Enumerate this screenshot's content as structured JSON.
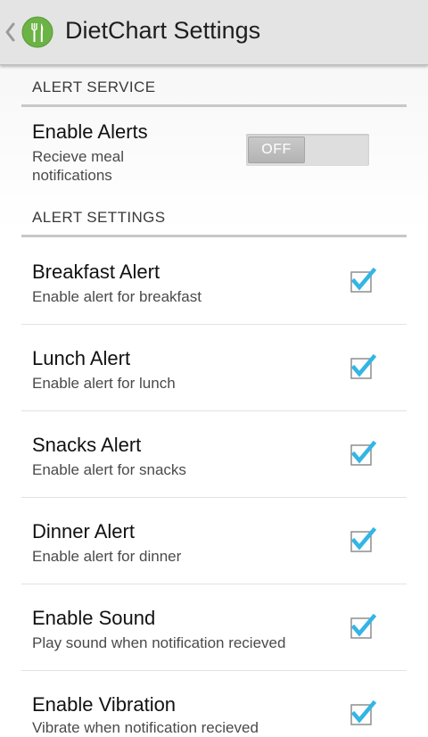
{
  "app": {
    "title": "DietChart Settings",
    "icon": "fork-knife-icon",
    "brand_color": "#6ab344"
  },
  "alert_service": {
    "header": "ALERT SERVICE",
    "enable_alerts": {
      "title": "Enable Alerts",
      "summary_line1": "Recieve meal",
      "summary_line2": "notifications",
      "toggle_label": "OFF",
      "toggle_state": "off"
    }
  },
  "alert_settings": {
    "header": "ALERT SETTINGS",
    "items": [
      {
        "title": "Breakfast Alert",
        "summary": "Enable alert for breakfast",
        "checked": true
      },
      {
        "title": "Lunch Alert",
        "summary": "Enable alert for lunch",
        "checked": true
      },
      {
        "title": "Snacks Alert",
        "summary": "Enable alert for snacks",
        "checked": true
      },
      {
        "title": "Dinner Alert",
        "summary": "Enable alert for dinner",
        "checked": true
      },
      {
        "title": "Enable Sound",
        "summary": "Play sound when notification recieved",
        "checked": true
      },
      {
        "title": "Enable Vibration",
        "summary": "Vibrate when notification recieved",
        "checked": true
      }
    ]
  },
  "colors": {
    "checkmark": "#33b5e5",
    "header_text": "#3a3a3a",
    "divider": "#c8c8c8"
  }
}
